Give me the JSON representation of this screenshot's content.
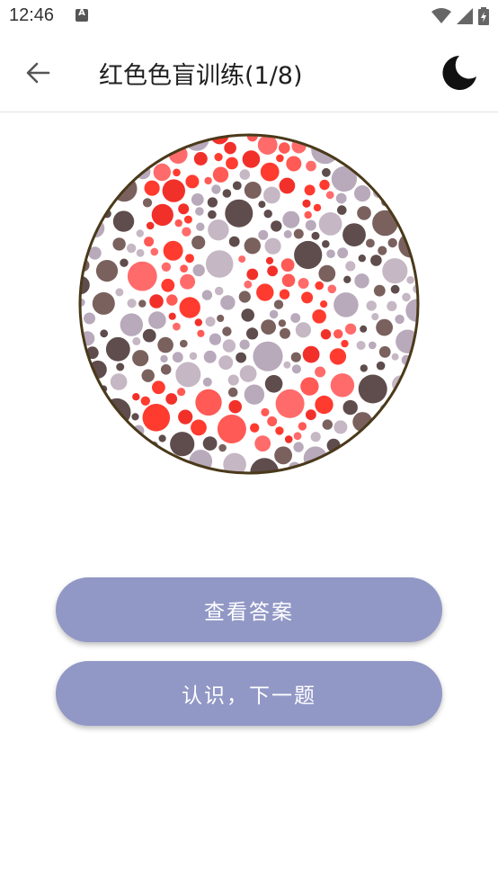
{
  "status_bar": {
    "time": "12:46",
    "notification_letter": "A",
    "icons": [
      "wifi-icon",
      "signal-icon",
      "battery-icon"
    ]
  },
  "app_bar": {
    "title": "红色色盲训练(1/8)",
    "back_icon": "arrow-left-icon",
    "theme_icon": "moon-icon"
  },
  "plate": {
    "figure_color": "#ff3b2f",
    "background_colors": [
      "#7a615e",
      "#b8a9bb",
      "#5f4c4c",
      "#c6b7c4"
    ],
    "border_color": "#4a3a1a"
  },
  "actions": {
    "show_answer": "查看答案",
    "next": "认识，下一题"
  },
  "colors": {
    "button": "#9198c6",
    "button_text": "#ffffff"
  }
}
